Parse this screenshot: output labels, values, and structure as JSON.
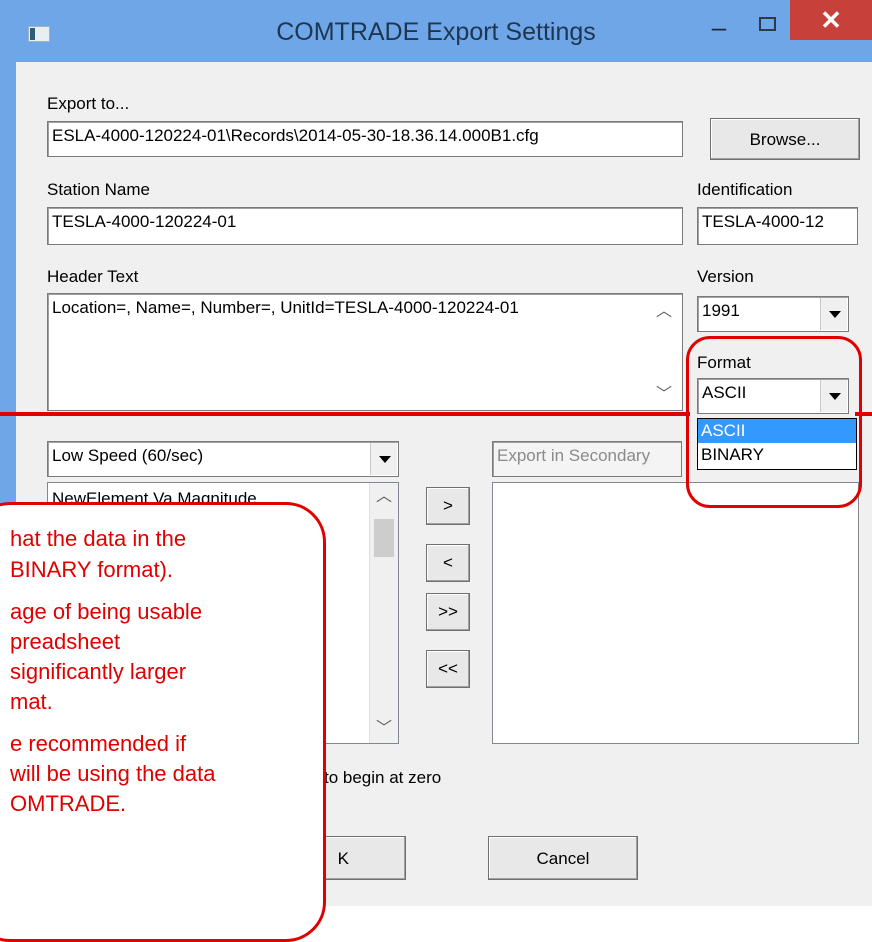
{
  "window": {
    "title": "COMTRADE Export Settings",
    "minimize_glyph": "–",
    "close_glyph": "✕",
    "icons": {
      "app": "app-window-icon",
      "maximize": "maximize-icon",
      "scroll_up": "chevron-up-icon",
      "scroll_down": "chevron-down-icon"
    }
  },
  "export": {
    "label": "Export to...",
    "path": "ESLA-4000-120224-01\\Records\\2014-05-30-18.36.14.000B1.cfg",
    "browse_label": "Browse..."
  },
  "station": {
    "label": "Station Name",
    "value": "TESLA-4000-120224-01"
  },
  "identification": {
    "label": "Identification",
    "value": "TESLA-4000-12"
  },
  "header": {
    "label": "Header Text",
    "value": "Location=, Name=, Number=, UnitId=TESLA-4000-120224-01"
  },
  "version": {
    "label": "Version",
    "selected": "1991"
  },
  "format": {
    "label": "Format",
    "selected": "ASCII",
    "options": [
      "ASCII",
      "BINARY"
    ],
    "highlighted": "ASCII"
  },
  "speed": {
    "selected": "Low Speed (60/sec)"
  },
  "secondary": {
    "placeholder": "Export in Secondary"
  },
  "channels": {
    "first_item": "NewElement.Va Magnitude"
  },
  "transfer_buttons": {
    "add": ">",
    "remove": "<",
    "add_all": ">>",
    "remove_all": "<<"
  },
  "time_option": {
    "label_fragment": "to begin at zero"
  },
  "footer": {
    "ok_label_fragment": "K",
    "cancel_label": "Cancel"
  },
  "callout": {
    "lines": [
      "hat the data in the",
      "BINARY format).",
      "age of being usable",
      "preadsheet",
      "significantly larger",
      "mat.",
      "e recommended if",
      "will be using the data",
      "OMTRADE."
    ]
  },
  "colors": {
    "annotation_red": "#e00000",
    "selection_blue": "#3399ff",
    "titlebar_blue": "#6ea6e8",
    "close_red": "#c7413a"
  }
}
